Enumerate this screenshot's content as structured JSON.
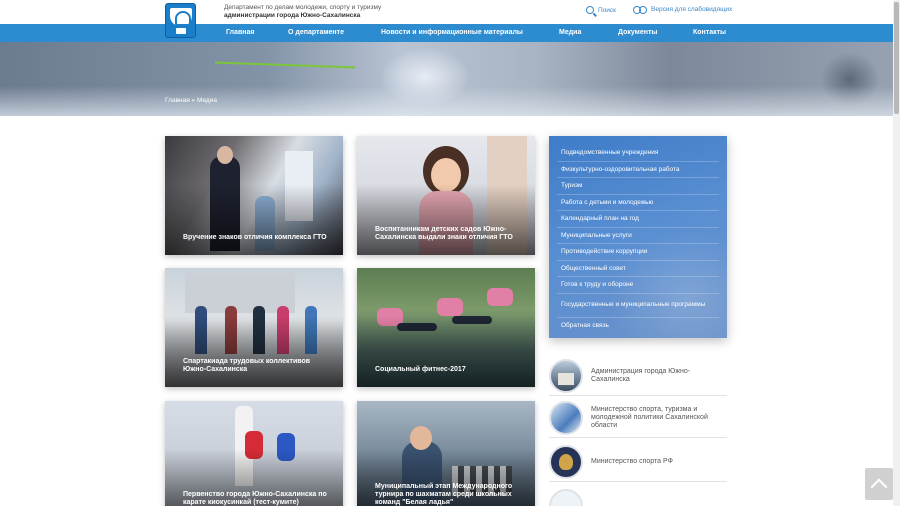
{
  "header": {
    "dept_line1": "Департамент по делам молодежи, спорту и туризму",
    "dept_line2": "администрации города Южно-Сахалинска",
    "search_label": "Поиск",
    "accessibility_label": "Версия для слабовидящих"
  },
  "nav": {
    "items": [
      "Главная",
      "О департаменте",
      "Новости и информационные материалы",
      "Медиа",
      "Документы",
      "Контакты"
    ]
  },
  "breadcrumb": "Главная » Медиа",
  "cards": [
    {
      "caption": "Вручение знаков отличия комплекса ГТО"
    },
    {
      "caption": "Воспитанникам детских садов Южно-Сахалинска выдали знаки отличия ГТО"
    },
    {
      "caption": "Спартакиада трудовых коллективов Южно-Сахалинска"
    },
    {
      "caption": "Социальный фитнес-2017"
    },
    {
      "caption": "Первенство города Южно-Сахалинска по карате киокусинкай (тест-кумите)"
    },
    {
      "caption": "Муниципальный этап Международного турнира по шахматам среди школьных команд \"Белая ладья\""
    }
  ],
  "side_menu": {
    "items": [
      "Подведомственные учреждения",
      "Физкультурно-оздоровительная работа",
      "Туризм",
      "Работа с детьми и молодежью",
      "Календарный план на год",
      "Муниципальные услуги",
      "Противодействие коррупции",
      "Общественный совет",
      "Готов к труду и обороне",
      "Государственные и муниципальные программы",
      "Обратная связь"
    ]
  },
  "partners": [
    {
      "name": "Администрация города Южно-Сахалинска"
    },
    {
      "name": "Министерство спорта, туризма и молодежной политики Сахалинской области"
    },
    {
      "name": "Министерство спорта РФ"
    },
    {
      "name": ""
    }
  ],
  "colors": {
    "nav_bg": "#2d8bd0",
    "link": "#3a87c9",
    "menu_bg": "#4a84cc"
  }
}
